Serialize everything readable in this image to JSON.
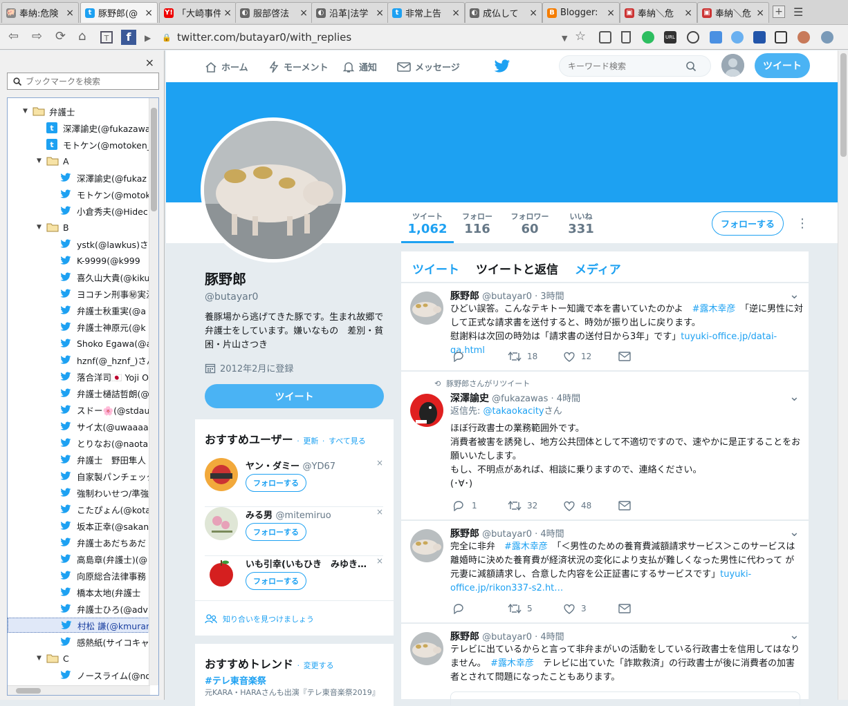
{
  "tabs": [
    {
      "title": "奉納:危険",
      "favcolor": "#888",
      "glyph": "🐖",
      "close": "×"
    },
    {
      "title": "豚野郎(@",
      "favcolor": "#1da1f2",
      "glyph": "t",
      "close": "×"
    },
    {
      "title": "「大崎事件",
      "favcolor": "#e00",
      "glyph": "Y!",
      "close": "×"
    },
    {
      "title": "服部啓法",
      "favcolor": "#666",
      "glyph": "◐",
      "close": "×"
    },
    {
      "title": "沿革|法学",
      "favcolor": "#666",
      "glyph": "◐",
      "close": "×"
    },
    {
      "title": "非常上告",
      "favcolor": "#1da1f2",
      "glyph": "t",
      "close": "×"
    },
    {
      "title": "成仏して",
      "favcolor": "#666",
      "glyph": "◐",
      "close": "×"
    },
    {
      "title": "Blogger:",
      "favcolor": "#f57d00",
      "glyph": "B",
      "close": "×"
    },
    {
      "title": "奉納＼危",
      "favcolor": "#c33",
      "glyph": "▣",
      "close": "×"
    },
    {
      "title": "奉納＼危",
      "favcolor": "#c33",
      "glyph": "▣",
      "close": "×"
    }
  ],
  "browser": {
    "url": "twitter.com/butayar0/with_replies"
  },
  "sidebar": {
    "close": "×",
    "search_placeholder": "ブックマークを検索",
    "rows": [
      {
        "type": "folder",
        "indent": 0,
        "label": "弁護士",
        "open": true
      },
      {
        "type": "tbk",
        "indent": 1,
        "label": "深澤諭史(@fukazawa"
      },
      {
        "type": "tbk",
        "indent": 1,
        "label": "モトケン(@motoken_"
      },
      {
        "type": "folder",
        "indent": 1,
        "label": "A",
        "open": true
      },
      {
        "type": "tw",
        "indent": 2,
        "label": "深澤諭史(@fukaz"
      },
      {
        "type": "tw",
        "indent": 2,
        "label": "モトケン(@motok"
      },
      {
        "type": "tw",
        "indent": 2,
        "label": "小倉秀夫(@Hidec"
      },
      {
        "type": "folder",
        "indent": 1,
        "label": "B",
        "open": true
      },
      {
        "type": "tw",
        "indent": 2,
        "label": "ystk(@lawkus)さん"
      },
      {
        "type": "tw",
        "indent": 2,
        "label": "K-9999(@k999"
      },
      {
        "type": "tw",
        "indent": 2,
        "label": "喜久山大貴(@kiku"
      },
      {
        "type": "tw",
        "indent": 2,
        "label": "ヨコチン刑事㊙実況"
      },
      {
        "type": "tw",
        "indent": 2,
        "label": "弁護士秋重実(@a"
      },
      {
        "type": "tw",
        "indent": 2,
        "label": "弁護士神原元(@k"
      },
      {
        "type": "tw",
        "indent": 2,
        "label": "Shoko Egawa(@a"
      },
      {
        "type": "tw",
        "indent": 2,
        "label": "hznf(@_hznf_)さん"
      },
      {
        "type": "tw",
        "indent": 2,
        "label": "落合洋司🇯🇵 Yoji O"
      },
      {
        "type": "tw",
        "indent": 2,
        "label": "弁護士樋詰哲朗(@"
      },
      {
        "type": "tw",
        "indent": 2,
        "label": "スドー🌸(@stdau"
      },
      {
        "type": "tw",
        "indent": 2,
        "label": "サイ太(@uwaaaa)"
      },
      {
        "type": "tw",
        "indent": 2,
        "label": "とりなお(@naotan"
      },
      {
        "type": "tw",
        "indent": 2,
        "label": "弁護士　野田隼人"
      },
      {
        "type": "tw",
        "indent": 2,
        "label": "自家製パンチェッタ"
      },
      {
        "type": "tw",
        "indent": 2,
        "label": "強制わいせつ/準強"
      },
      {
        "type": "tw",
        "indent": 2,
        "label": "こたぴょん(@kota"
      },
      {
        "type": "tw",
        "indent": 2,
        "label": "坂本正幸(@sakan"
      },
      {
        "type": "tw",
        "indent": 2,
        "label": "弁護士あだちあだ"
      },
      {
        "type": "tw",
        "indent": 2,
        "label": "高島章(弁護士)(@"
      },
      {
        "type": "tw",
        "indent": 2,
        "label": "向原総合法律事務"
      },
      {
        "type": "tw",
        "indent": 2,
        "label": "橋本太地(弁護士"
      },
      {
        "type": "tw",
        "indent": 2,
        "label": "弁護士ひろ(@adv"
      },
      {
        "type": "tw",
        "indent": 2,
        "label": "村松 謙(@kmurar",
        "selected": true
      },
      {
        "type": "tw",
        "indent": 2,
        "label": "感熱紙(サイコキャ"
      },
      {
        "type": "folder",
        "indent": 1,
        "label": "C",
        "open": true
      },
      {
        "type": "tw",
        "indent": 2,
        "label": "ノースライム(@no"
      }
    ]
  },
  "twnav": {
    "home": "ホーム",
    "moments": "モーメント",
    "notifications": "通知",
    "messages": "メッセージ",
    "search_placeholder": "キーワード検索",
    "tweet": "ツイート"
  },
  "profile": {
    "stats": [
      {
        "label": "ツイート",
        "value": "1,062"
      },
      {
        "label": "フォロー",
        "value": "116"
      },
      {
        "label": "フォロワー",
        "value": "60"
      },
      {
        "label": "いいね",
        "value": "331"
      }
    ],
    "follow": "フォローする",
    "name": "豚野郎",
    "handle": "@butayar0",
    "bio": "養豚場から逃げてきた豚です。生まれ故郷で弁護士をしています。嫌いなもの　差別・貧困・片山さつき",
    "joined": "2012年2月に登録",
    "tweet_btn": "ツイート"
  },
  "who_to_follow": {
    "title": "おすすめユーザー",
    "refresh": "更新",
    "sep": "·",
    "view_all": "すべて見る",
    "users": [
      {
        "name": "ヤン・ダミー",
        "handle": "@YD67",
        "follow": "フォローする",
        "close": "×"
      },
      {
        "name": "みる男",
        "handle": "@mitemiruo",
        "follow": "フォローする",
        "close": "×"
      },
      {
        "name": "いも引幸(いもひき　みゆき…",
        "handle": "",
        "follow": "フォローする",
        "close": "×"
      }
    ],
    "find_friends": "知り合いを見つけましょう"
  },
  "trends": {
    "title": "おすすめトレンド",
    "change": "変更する",
    "sep": "·",
    "items": [
      {
        "tag": "#テレ東音楽祭",
        "desc": "元KARA・HARAさんも出演『テレ東音楽祭2019』"
      }
    ]
  },
  "profile_tabs": [
    "ツイート",
    "ツイートと返信",
    "メディア"
  ],
  "tweets": [
    {
      "name": "豚野郎",
      "handle": "@butayar0",
      "time": "· 3時間",
      "body_html": "ひどい誤答。こんなテキトー知識で本を書いていたのかよ　<a>#露木幸彦</a>　「逆に男性に対して正式な請求書を送付すると、時効が振り出しに戻ります。<br>慰謝料は次回の時効は「請求書の送付日から3年」です」<a>tuyuki-office.jp/datai-qa.html</a>",
      "reply": "",
      "rt": "18",
      "like": "12"
    },
    {
      "retweeted_by": "豚野郎さんがリツイート",
      "name": "深澤諭史",
      "handle": "@fukazawas",
      "time": "· 4時間",
      "reply_to_label": "返信先:",
      "reply_to": "@takaokacity",
      "reply_to_suffix": "さん",
      "body_html": "ほぼ行政書士の業務範囲外です。<br>消費者被害を誘発し、地方公共団体として不適切ですので、速やかに是正することをお願いいたします。<br>もし、不明点があれば、相談に乗りますので、連絡ください。<br>(･∀･)",
      "reply": "1",
      "rt": "32",
      "like": "48"
    },
    {
      "name": "豚野郎",
      "handle": "@butayar0",
      "time": "· 4時間",
      "body_html": "完全に非弁　<a>#露木幸彦</a>　「＜男性のための養育費減額請求サービス＞このサービスは離婚時に決めた養育費が経済状況の変化により支払が難しくなった男性に代わって が元妻に減額請求し、合意した内容を公正証書にするサービスです」<a>tuyuki-office.jp/rikon337-s2.ht…</a>",
      "reply": "",
      "rt": "5",
      "like": "3"
    },
    {
      "name": "豚野郎",
      "handle": "@butayar0",
      "time": "· 4時間",
      "body_html": "テレビに出ているからと言って非弁まがいの活動をしている行政書士を信用してはなりません。　<a>#露木幸彦</a>　テレビに出ていた「詐欺救済」の行政書士が後に消費者の加害者とされて問題になったこともあります。",
      "reply": "",
      "rt": "",
      "like": ""
    }
  ],
  "colors": {
    "twitter_blue": "#1da1f2",
    "banner": "#1da1f2"
  }
}
